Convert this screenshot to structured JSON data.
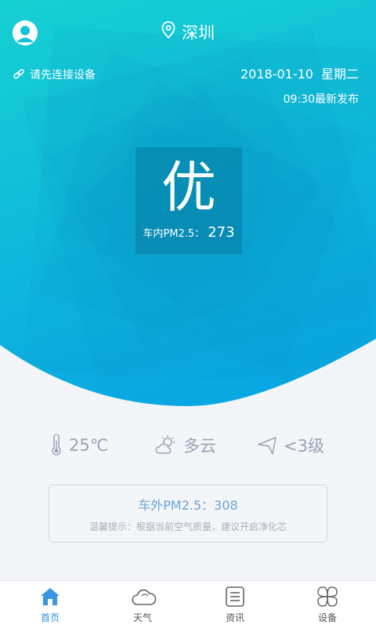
{
  "header": {
    "city": "深圳",
    "device_link": "请先连接设备",
    "date": "2018-01-10",
    "weekday": "星期二",
    "publish": "09:30最新发布"
  },
  "air_quality": {
    "grade": "优",
    "pm_label": "车内PM2.5：",
    "pm_value": "273"
  },
  "weather": {
    "temperature": "25℃",
    "condition": "多云",
    "wind": "<3级"
  },
  "outside": {
    "pm_text": "车外PM2.5：308",
    "tip": "温馨提示：根据当前空气质量，建议开启净化芯"
  },
  "tabs": [
    {
      "label": "首页",
      "icon": "home-icon",
      "active": true
    },
    {
      "label": "天气",
      "icon": "cloud-icon",
      "active": false
    },
    {
      "label": "资讯",
      "icon": "news-icon",
      "active": false
    },
    {
      "label": "设备",
      "icon": "device-icon",
      "active": false
    }
  ],
  "colors": {
    "hero_top": "#12c8d3",
    "hero_bottom": "#0aa7e2",
    "active_tab": "#2f8fde",
    "muted_text": "#9aa3b5"
  }
}
